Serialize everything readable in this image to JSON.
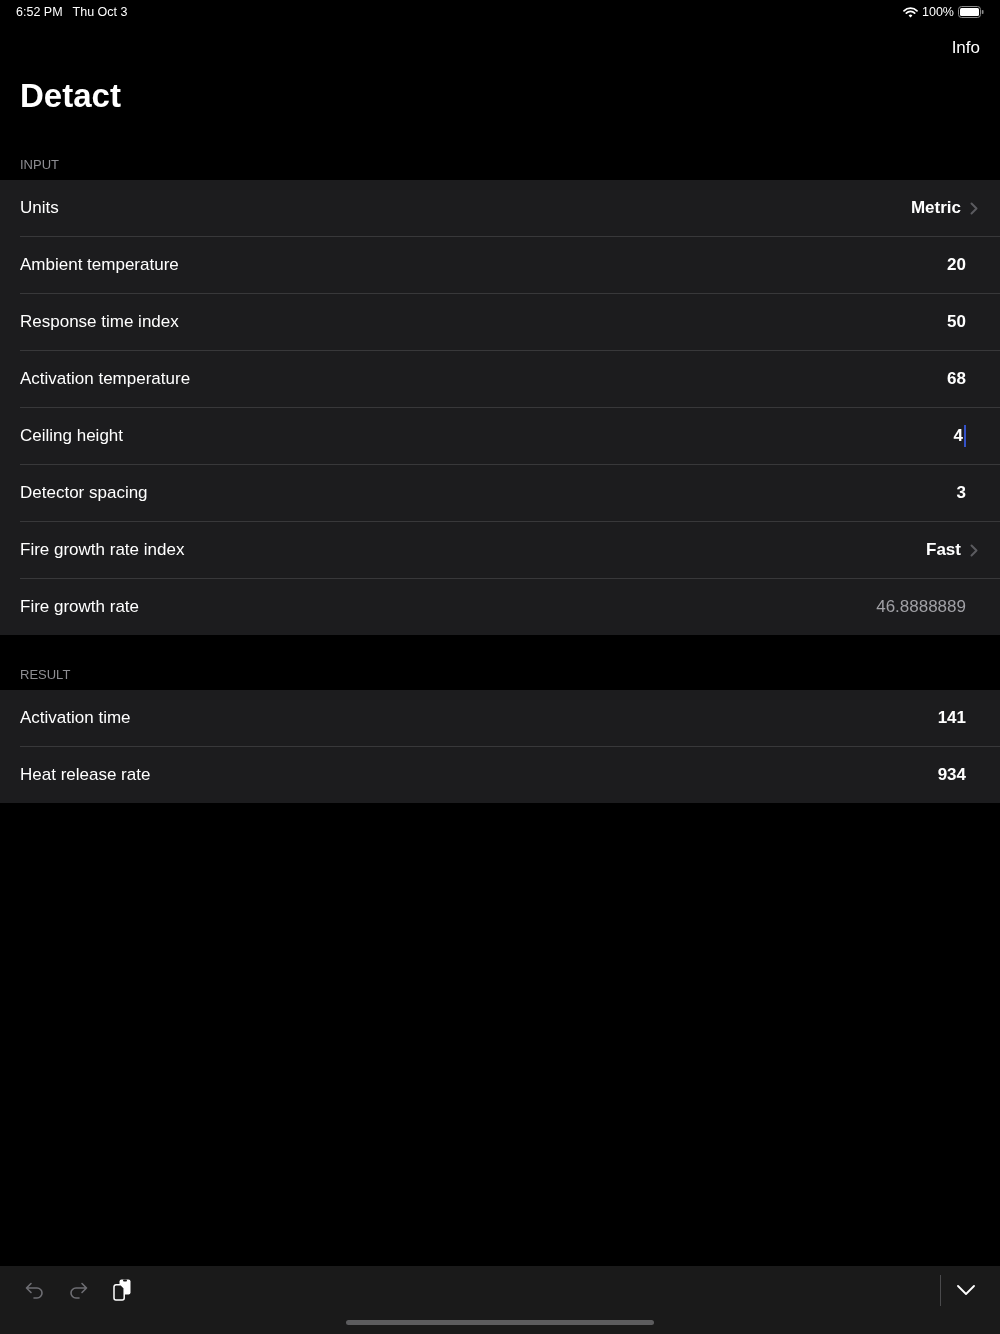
{
  "status_bar": {
    "time": "6:52 PM",
    "date": "Thu Oct 3",
    "battery": "100%"
  },
  "nav": {
    "action": "Info",
    "title": "Detact"
  },
  "sections": [
    {
      "header": "INPUT",
      "rows": [
        {
          "kind": "picker",
          "label": "Units",
          "value": "Metric"
        },
        {
          "kind": "input",
          "label": "Ambient temperature",
          "value": "20",
          "focused": false
        },
        {
          "kind": "input",
          "label": "Response time index",
          "value": "50",
          "focused": false
        },
        {
          "kind": "input",
          "label": "Activation temperature",
          "value": "68",
          "focused": false
        },
        {
          "kind": "input",
          "label": "Ceiling height",
          "value": "4",
          "focused": true
        },
        {
          "kind": "input",
          "label": "Detector spacing",
          "value": "3",
          "focused": false
        },
        {
          "kind": "picker",
          "label": "Fire growth rate index",
          "value": "Fast"
        },
        {
          "kind": "readonly",
          "label": "Fire growth rate",
          "value": "46.8888889"
        }
      ]
    },
    {
      "header": "RESULT",
      "rows": [
        {
          "kind": "output",
          "label": "Activation time",
          "value": "141"
        },
        {
          "kind": "output",
          "label": "Heat release rate",
          "value": "934"
        }
      ]
    }
  ],
  "keyboard_bar": {
    "leading_buttons": [
      {
        "kind": "undo",
        "disabled": true
      },
      {
        "kind": "redo",
        "disabled": true
      },
      {
        "kind": "paste",
        "disabled": false
      }
    ],
    "trailing_buttons": [
      {
        "kind": "dismiss",
        "disabled": false
      }
    ]
  }
}
